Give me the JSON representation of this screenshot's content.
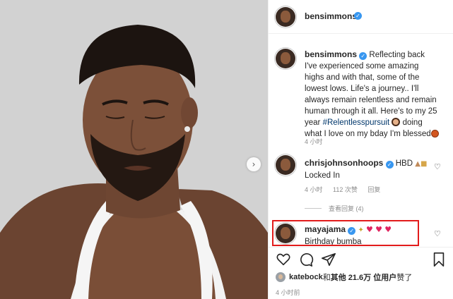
{
  "post": {
    "username": "bensimmons",
    "caption_username": "bensimmons",
    "caption_text_1": " Reflecting back I've experienced some amazing highs and with that, some of the lowest lows. Life's a journey.. I'll always remain relentless and remain human through it all. Here's to my 25 year ",
    "hashtag": "#Relentlesspursuit",
    "caption_text_2": " doing what I love on my bday I'm blessed",
    "caption_time": "4 小时"
  },
  "comments": [
    {
      "username": "chrisjohnsonhoops",
      "text": " HBD",
      "line2": "Locked In",
      "time": "4 小时",
      "likes": "112 次赞",
      "reply": "回复",
      "view_replies": "查看回复 (4)"
    },
    {
      "username": "mayajama",
      "line2": "Birthday bumba"
    }
  ],
  "likes_bar": {
    "user": "katebock",
    "and_text": " 和 ",
    "others": "其他 21.6万 位用户",
    "suffix": " 赞了"
  },
  "post_time": "4 小时前",
  "icons": [
    "verified-icon",
    "heart-icon",
    "comment-icon",
    "share-icon",
    "bookmark-icon",
    "chevron-right-icon"
  ],
  "colors": {
    "highlight_border": "#e21b1b",
    "verified": "#3897f0",
    "hashtag": "#00376b",
    "meta": "#8e8e8e"
  }
}
